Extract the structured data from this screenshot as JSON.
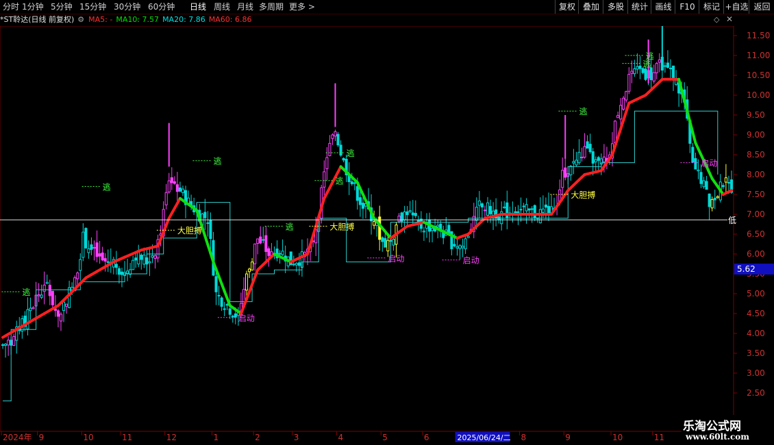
{
  "toolbar": {
    "periods": [
      "分时",
      "1分钟",
      "5分钟",
      "15分钟",
      "30分钟",
      "60分钟",
      "日线",
      "周线",
      "月线",
      "多周期",
      "更多 >"
    ],
    "active_period": "日线",
    "buttons": [
      "复权",
      "叠加",
      "多股",
      "统计",
      "画线",
      "F10",
      "标记",
      "+自选",
      "返回"
    ]
  },
  "legend": {
    "stock": "*ST聆达(日线 前复权)",
    "ma5": "MA5: -",
    "ma10": "MA10: 7.57",
    "ma20": "MA20: 7.86",
    "ma60": "MA60: 6.86",
    "colors": {
      "ma5": "#ff3030",
      "ma10": "#00e000",
      "ma20": "#00e0e0",
      "ma60": "#ff3030"
    }
  },
  "chart_data": {
    "type": "candlestick",
    "y_ticks": [
      11.5,
      11.0,
      10.5,
      10.0,
      9.5,
      9.0,
      8.5,
      8.0,
      7.5,
      7.0,
      6.5,
      6.0,
      5.5,
      5.0,
      4.5,
      4.0,
      3.5,
      3.0,
      2.5
    ],
    "y_range": [
      2.0,
      12.0
    ],
    "x_labels": [
      {
        "text": "2024年",
        "index": 0
      },
      {
        "text": "9",
        "index": 13
      },
      {
        "text": "10",
        "index": 29
      },
      {
        "text": "11",
        "index": 43
      },
      {
        "text": "12",
        "index": 59
      },
      {
        "text": "1",
        "index": 76
      },
      {
        "text": "2",
        "index": 91
      },
      {
        "text": "3",
        "index": 105
      },
      {
        "text": "4",
        "index": 121
      },
      {
        "text": "5",
        "index": 137
      },
      {
        "text": "6",
        "index": 152
      },
      {
        "text": "2025/06/24/二",
        "index": 164
      },
      {
        "text": "8",
        "index": 187
      },
      {
        "text": "9",
        "index": 203
      },
      {
        "text": "10",
        "index": 220
      },
      {
        "text": "11",
        "index": 235
      }
    ],
    "current_price": "5.62",
    "low_line": {
      "value": 6.86,
      "label": "低"
    },
    "annotations": [
      {
        "text": "逃",
        "index": 7,
        "price": 5.05,
        "color": "#40ff40"
      },
      {
        "text": "逃",
        "index": 36,
        "price": 7.7,
        "color": "#40ff40"
      },
      {
        "text": "逃",
        "index": 76,
        "price": 8.35,
        "color": "#40ff40"
      },
      {
        "text": "大胆搏",
        "index": 63,
        "price": 6.6,
        "color": "#ffff40"
      },
      {
        "text": "启动",
        "index": 85,
        "price": 4.4,
        "color": "#ff40ff"
      },
      {
        "text": "逃",
        "index": 102,
        "price": 6.7,
        "color": "#40ff40"
      },
      {
        "text": "逃",
        "index": 124,
        "price": 8.55,
        "color": "#40ff40"
      },
      {
        "text": "逃",
        "index": 120,
        "price": 7.85,
        "color": "#40ff40"
      },
      {
        "text": "大胆搏",
        "index": 118,
        "price": 6.7,
        "color": "#ffff40"
      },
      {
        "text": "启动",
        "index": 139,
        "price": 5.9,
        "color": "#ff40ff"
      },
      {
        "text": "启动",
        "index": 166,
        "price": 5.85,
        "color": "#ff40ff"
      },
      {
        "text": "大胆搏",
        "index": 205,
        "price": 7.5,
        "color": "#ffff40"
      },
      {
        "text": "逃",
        "index": 208,
        "price": 9.6,
        "color": "#40ff40"
      },
      {
        "text": "逃",
        "index": 232,
        "price": 11.0,
        "color": "#40ff40"
      },
      {
        "text": "逃",
        "index": 231,
        "price": 10.8,
        "color": "#40ff40"
      },
      {
        "text": "启动",
        "index": 252,
        "price": 8.3,
        "color": "#ff40ff"
      }
    ],
    "anchors": [
      [
        0,
        3.7
      ],
      [
        4,
        3.9
      ],
      [
        8,
        4.3
      ],
      [
        12,
        4.9
      ],
      [
        16,
        5.2
      ],
      [
        20,
        4.4
      ],
      [
        23,
        4.9
      ],
      [
        26,
        5.3
      ],
      [
        29,
        6.4
      ],
      [
        32,
        6.1
      ],
      [
        36,
        5.8
      ],
      [
        40,
        5.8
      ],
      [
        44,
        5.5
      ],
      [
        48,
        6.0
      ],
      [
        52,
        5.8
      ],
      [
        56,
        6.2
      ],
      [
        60,
        7.9
      ],
      [
        63,
        7.7
      ],
      [
        67,
        7.3
      ],
      [
        71,
        7.0
      ],
      [
        74,
        6.9
      ],
      [
        77,
        5.0
      ],
      [
        81,
        4.7
      ],
      [
        85,
        4.4
      ],
      [
        88,
        5.5
      ],
      [
        92,
        6.4
      ],
      [
        96,
        6.0
      ],
      [
        100,
        6.1
      ],
      [
        104,
        5.8
      ],
      [
        108,
        5.9
      ],
      [
        111,
        6.1
      ],
      [
        114,
        7.0
      ],
      [
        117,
        8.5
      ],
      [
        120,
        9.1
      ],
      [
        123,
        8.3
      ],
      [
        126,
        7.8
      ],
      [
        130,
        7.2
      ],
      [
        134,
        6.9
      ],
      [
        137,
        6.3
      ],
      [
        140,
        6.3
      ],
      [
        143,
        6.9
      ],
      [
        146,
        7.1
      ],
      [
        150,
        6.7
      ],
      [
        154,
        6.7
      ],
      [
        158,
        6.6
      ],
      [
        162,
        6.3
      ],
      [
        166,
        6.2
      ],
      [
        169,
        6.7
      ],
      [
        172,
        7.2
      ],
      [
        176,
        7.1
      ],
      [
        180,
        7.0
      ],
      [
        184,
        7.1
      ],
      [
        188,
        7.1
      ],
      [
        192,
        7.0
      ],
      [
        196,
        7.1
      ],
      [
        199,
        7.0
      ],
      [
        202,
        8.0
      ],
      [
        206,
        8.3
      ],
      [
        210,
        8.6
      ],
      [
        214,
        8.3
      ],
      [
        218,
        8.3
      ],
      [
        222,
        9.6
      ],
      [
        226,
        10.4
      ],
      [
        230,
        10.6
      ],
      [
        234,
        10.5
      ],
      [
        238,
        10.8
      ],
      [
        242,
        10.5
      ],
      [
        246,
        9.8
      ],
      [
        249,
        8.2
      ],
      [
        252,
        7.9
      ],
      [
        255,
        7.3
      ],
      [
        258,
        7.5
      ],
      [
        260,
        7.8
      ],
      [
        263,
        7.7
      ]
    ],
    "ma": [
      [
        0,
        3.9
      ],
      [
        10,
        4.3
      ],
      [
        20,
        4.7
      ],
      [
        30,
        5.4
      ],
      [
        40,
        5.8
      ],
      [
        50,
        6.1
      ],
      [
        56,
        6.2
      ],
      [
        60,
        6.9
      ],
      [
        64,
        7.4
      ],
      [
        70,
        7.1
      ],
      [
        76,
        5.8
      ],
      [
        82,
        4.7
      ],
      [
        86,
        4.5
      ],
      [
        92,
        5.6
      ],
      [
        98,
        6.0
      ],
      [
        104,
        5.8
      ],
      [
        110,
        6.0
      ],
      [
        116,
        7.4
      ],
      [
        122,
        8.2
      ],
      [
        128,
        7.8
      ],
      [
        134,
        6.9
      ],
      [
        140,
        6.4
      ],
      [
        146,
        6.7
      ],
      [
        152,
        6.8
      ],
      [
        158,
        6.6
      ],
      [
        164,
        6.4
      ],
      [
        168,
        6.5
      ],
      [
        174,
        6.9
      ],
      [
        180,
        7.0
      ],
      [
        190,
        7.0
      ],
      [
        198,
        7.0
      ],
      [
        204,
        7.6
      ],
      [
        210,
        8.0
      ],
      [
        216,
        8.1
      ],
      [
        220,
        8.5
      ],
      [
        226,
        9.8
      ],
      [
        232,
        10.0
      ],
      [
        238,
        10.4
      ],
      [
        244,
        10.4
      ],
      [
        250,
        8.8
      ],
      [
        256,
        7.9
      ],
      [
        260,
        7.5
      ],
      [
        263,
        7.6
      ]
    ],
    "envelope": [
      [
        0,
        2.3
      ],
      [
        3,
        2.3
      ],
      [
        3,
        4.1
      ],
      [
        12,
        4.1
      ],
      [
        12,
        5.1
      ],
      [
        28,
        5.1
      ],
      [
        28,
        5.3
      ],
      [
        36,
        5.3
      ],
      [
        36,
        5.3
      ],
      [
        44,
        5.3
      ],
      [
        44,
        5.5
      ],
      [
        52,
        5.5
      ],
      [
        52,
        6.0
      ],
      [
        58,
        6.0
      ],
      [
        58,
        6.4
      ],
      [
        70,
        6.4
      ],
      [
        70,
        7.3
      ],
      [
        82,
        7.3
      ],
      [
        82,
        4.8
      ],
      [
        90,
        4.8
      ],
      [
        90,
        5.5
      ],
      [
        98,
        5.5
      ],
      [
        98,
        5.6
      ],
      [
        108,
        5.6
      ],
      [
        108,
        5.8
      ],
      [
        114,
        5.8
      ],
      [
        114,
        6.9
      ],
      [
        124,
        6.9
      ],
      [
        124,
        5.8
      ],
      [
        140,
        5.8
      ],
      [
        140,
        6.8
      ],
      [
        168,
        6.8
      ],
      [
        168,
        6.9
      ],
      [
        204,
        6.9
      ],
      [
        204,
        8.2
      ],
      [
        216,
        8.2
      ],
      [
        216,
        8.3
      ],
      [
        228,
        8.3
      ],
      [
        228,
        9.6
      ],
      [
        258,
        9.6
      ],
      [
        258,
        8.0
      ]
    ],
    "upper_steps": [
      [
        0,
        4.9
      ],
      [
        7,
        4.9
      ],
      [
        7,
        5.2
      ],
      [
        30,
        5.2
      ],
      [
        30,
        7.7
      ],
      [
        36,
        7.7
      ],
      [
        60,
        8.3
      ],
      [
        76,
        8.3
      ],
      [
        92,
        6.7
      ],
      [
        102,
        6.7
      ],
      [
        114,
        7.3
      ],
      [
        120,
        8.6
      ],
      [
        204,
        9.6
      ],
      [
        208,
        9.6
      ],
      [
        226,
        10.8
      ],
      [
        232,
        11.0
      ]
    ]
  }
}
